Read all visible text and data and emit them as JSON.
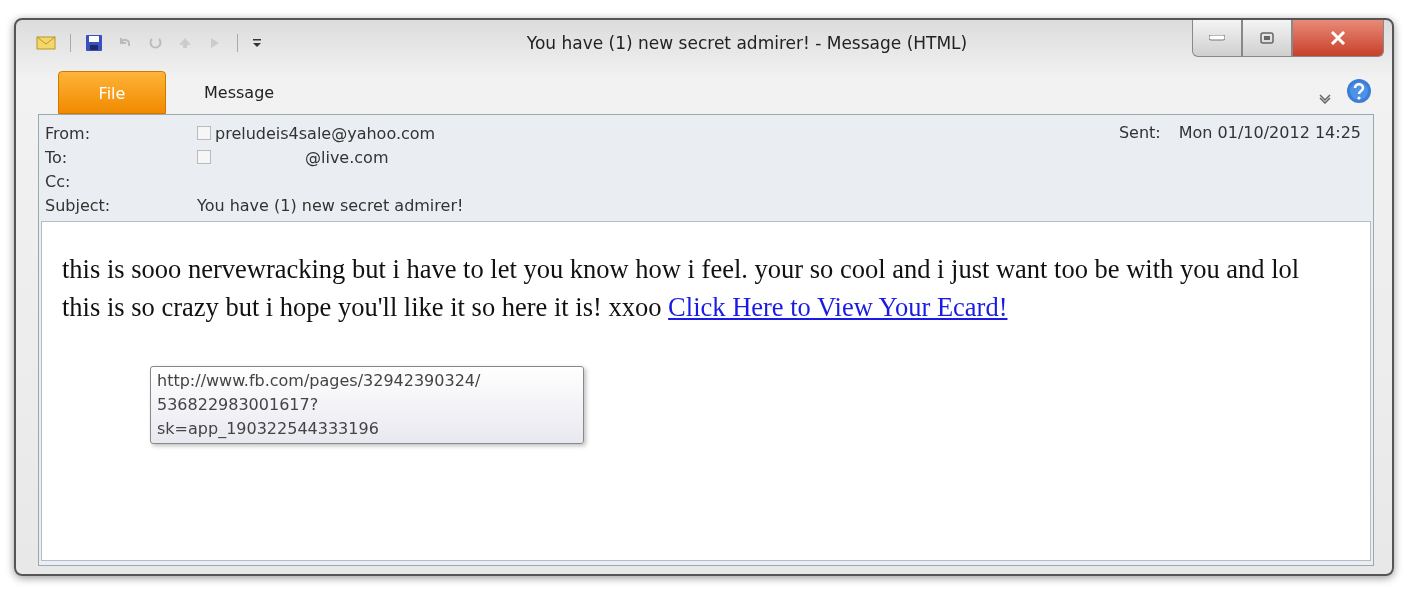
{
  "window": {
    "title": "You have (1) new secret admirer!  -  Message (HTML)"
  },
  "tabs": [
    {
      "label": "File",
      "kind": "backstage",
      "selected": false
    },
    {
      "label": "Message",
      "kind": "ribbon",
      "selected": true
    }
  ],
  "header": {
    "fields": [
      {
        "label": "From:",
        "value": "preludeis4sale@yahoo.com",
        "contact_icon": true
      },
      {
        "label": "To:",
        "value": "@live.com",
        "contact_icon": true
      },
      {
        "label": "Cc:",
        "contact_icon": false
      },
      {
        "label": "Subject:",
        "value": "You have (1) new secret admirer!",
        "contact_icon": false
      }
    ],
    "sent_label": "Sent:",
    "sent_value": "Mon 01/10/2012 14:25"
  },
  "body": {
    "text": "this is sooo nervewracking but i have to let you know how i feel. your so cool and i just want too be with you and lol this is so crazy but i hope you'll like it so here it is! xxoo",
    "link": "Click Here to View Your Ecard!"
  },
  "tooltip": {
    "lines": [
      "http://www.fb.com/pages/32942390324/",
      "536822983001617?",
      "sk=app_190322544333196"
    ]
  }
}
